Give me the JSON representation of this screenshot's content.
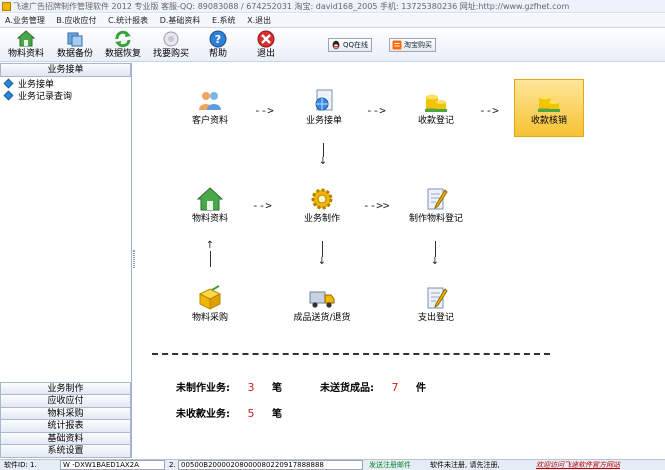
{
  "window": {
    "title": "飞速广告招牌制作管理软件 2012 专业版 客服-QQ: 89083088 / 674252031  淘宝: david168_2005  手机: 13725380236  网址:http://www.gzfhet.com"
  },
  "menu": [
    {
      "label": "A.业务管理"
    },
    {
      "label": "B.应收应付"
    },
    {
      "label": "C.统计报表"
    },
    {
      "label": "D.基础资料"
    },
    {
      "label": "E.系统"
    },
    {
      "label": "X.退出"
    }
  ],
  "toolbar": {
    "buttons": [
      {
        "label": "物料资料",
        "icon": "house-icon"
      },
      {
        "label": "数据备份",
        "icon": "backup-icon"
      },
      {
        "label": "数据恢复",
        "icon": "restore-icon"
      },
      {
        "label": "找要购买",
        "icon": "buy-icon"
      },
      {
        "label": "帮助",
        "icon": "help-icon"
      },
      {
        "label": "退出",
        "icon": "exit-icon"
      }
    ],
    "qq_label": "QQ在线",
    "taobao_label": "淘宝购买"
  },
  "sidebar": {
    "header": "业务接单",
    "items": [
      {
        "label": "业务接单"
      },
      {
        "label": "业务记录查询"
      }
    ],
    "sections": [
      {
        "label": "业务制作"
      },
      {
        "label": "应收应付"
      },
      {
        "label": "物料采购"
      },
      {
        "label": "统计报表"
      },
      {
        "label": "基础资料"
      },
      {
        "label": "系统设置"
      }
    ]
  },
  "workflow": {
    "arrow_h": "-->",
    "arrow_h_long": "-->>",
    "arrow_down": "↓",
    "arrow_up": "↑",
    "nodes": {
      "customer": "客户资料",
      "order": "业务接单",
      "payment": "收款登记",
      "verify": "收款核销",
      "material": "物料资料",
      "production": "业务制作",
      "material_register": "制作物料登记",
      "purchase": "物料采购",
      "delivery": "成品送货/退货",
      "expense": "支出登记"
    }
  },
  "stats": {
    "unmade_label": "未制作业务:",
    "unmade_value": "3",
    "unmade_unit": "笔",
    "undelivered_label": "未送货成品:",
    "undelivered_value": "7",
    "undelivered_unit": "件",
    "unpaid_label": "未收款业务:",
    "unpaid_value": "5",
    "unpaid_unit": "笔"
  },
  "statusbar": {
    "software_id_label": "软件ID: 1.",
    "software_id_value": "W -DXW1BAED1AX2A",
    "field2_label": "2.",
    "field2_value": "00500B20000208000080220917888888",
    "register_link": "发送注册邮件",
    "unregistered": "软件未注册, 请先注册,",
    "website": "欢迎访问飞速软件官方网站"
  },
  "colors": {
    "accent_highlight": "#f6c232",
    "stat_number": "#d81d1d",
    "panel_border": "#9fb0c8"
  }
}
